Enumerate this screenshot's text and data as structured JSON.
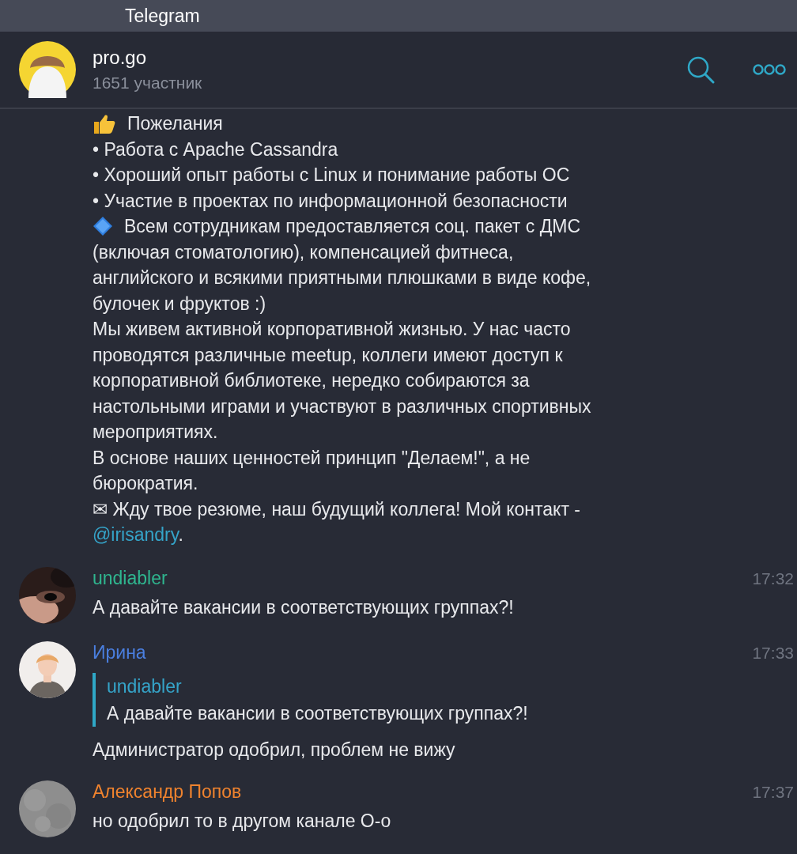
{
  "window": {
    "title": "Telegram"
  },
  "chat": {
    "title": "pro.go",
    "subtitle": "1651 участник"
  },
  "post": {
    "lines": [
      {
        "kind": "emoji",
        "text": "Пожелания"
      },
      {
        "text": "• Работа с Apache Cassandra"
      },
      {
        "text": "• Хороший опыт работы с Linux и понимание работы ОС"
      },
      {
        "text": "• Участие в проектах по информационной безопасности"
      },
      {
        "kind": "emoji",
        "text": "Всем сотрудникам предоставляется соц. пакет с ДМС"
      },
      {
        "text": "(включая стоматологию), компенсацией фитнеса,"
      },
      {
        "text": "английского и всякими приятными плюшками в виде кофе,"
      },
      {
        "text": "булочек и фруктов :)"
      },
      {
        "text": "Мы живем активной корпоративной жизнью. У нас часто"
      },
      {
        "text": "проводятся различные meetup, коллеги имеют доступ к"
      },
      {
        "text": "корпоративной библиотеке, нередко собираются за"
      },
      {
        "text": "настольными играми и участвуют в различных спортивных"
      },
      {
        "text": "мероприятиях."
      },
      {
        "text": "В основе наших ценностей принцип \"Делаем!\", а не"
      },
      {
        "text": "бюрократия."
      },
      {
        "text": "✉ Жду твое резюме, наш будущий коллега! Мой контакт -"
      },
      {
        "link": "@irisandry",
        "text": "."
      }
    ]
  },
  "messages": [
    {
      "author": "undiabler",
      "color": "#2fb68f",
      "time": "17:32",
      "text": "А давайте вакансии в соответствующих группах?!"
    },
    {
      "author": "Ирина",
      "color": "#4a7fe0",
      "time": "17:33",
      "reply": {
        "author": "undiabler",
        "text": "А давайте вакансии в соответствующих группах?!"
      },
      "text": "Администратор одобрил, проблем не вижу"
    },
    {
      "author": "Александр Попов",
      "color": "#f0832e",
      "time": "17:37",
      "text": "но одобрил то в другом канале О-о"
    }
  ]
}
